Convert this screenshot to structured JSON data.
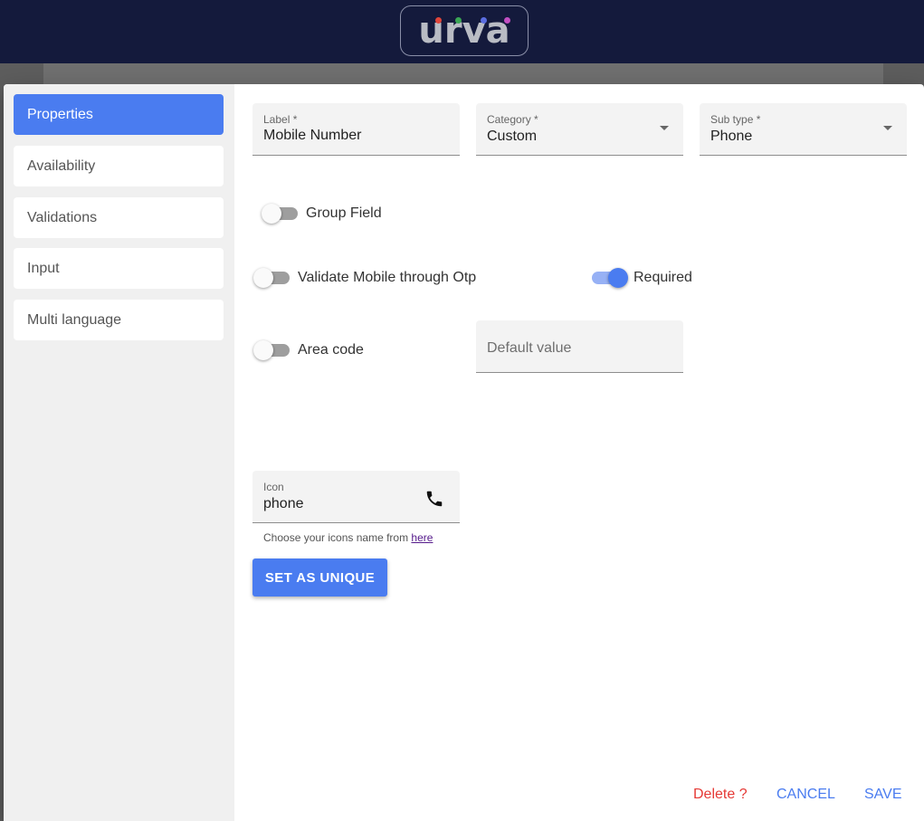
{
  "app": {
    "logo_text": "urva",
    "logo_dot_colors": [
      "#e0453a",
      "#3aa655",
      "#5b6ee0",
      "#c24fc2"
    ]
  },
  "sidebar": {
    "items": [
      {
        "label": "Properties",
        "active": true
      },
      {
        "label": "Availability"
      },
      {
        "label": "Validations"
      },
      {
        "label": "Input"
      },
      {
        "label": "Multi language"
      }
    ]
  },
  "form": {
    "label_field": {
      "label": "Label *",
      "value": "Mobile Number"
    },
    "category_field": {
      "label": "Category *",
      "value": "Custom"
    },
    "subtype_field": {
      "label": "Sub type *",
      "value": "Phone"
    },
    "group_field": {
      "label": "Group Field",
      "on": false
    },
    "validate_otp": {
      "label": "Validate Mobile through Otp",
      "on": false
    },
    "required": {
      "label": "Required",
      "on": true
    },
    "area_code": {
      "label": "Area code",
      "on": false
    },
    "default_value": {
      "placeholder": "Default value"
    },
    "icon_field": {
      "label": "Icon",
      "value": "phone",
      "icon": "phone-icon"
    },
    "icon_hint": {
      "text": "Choose your icons name from ",
      "link": "here"
    },
    "unique_button": "SET AS UNIQUE"
  },
  "actions": {
    "delete": "Delete ?",
    "cancel": "CANCEL",
    "save": "SAVE"
  },
  "colors": {
    "accent": "#4a7cf0",
    "header": "#141a3c",
    "danger": "#e53935"
  }
}
